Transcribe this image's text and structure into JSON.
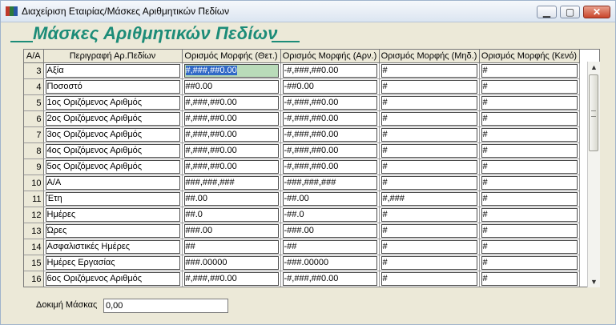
{
  "window": {
    "title": "Διαχείριση Εταιρίας/Μάσκες Αριθμητικών Πεδίων",
    "minimize_glyph": "▁",
    "maximize_glyph": "▢",
    "close_glyph": "✕",
    "icon": "app-logo-icon"
  },
  "header": {
    "title": "Μάσκες Αριθμητικών Πεδίων"
  },
  "grid": {
    "columns": [
      "Α/Α",
      "Περιγραφή Αρ.Πεδίων",
      "Ορισμός Μορφής (Θετ.)",
      "Ορισμός Μορφής (Αρν.)",
      "Ορισμός Μορφής (Μηδ.)",
      "Ορισμός Μορφής (Κενό)"
    ],
    "rows": [
      {
        "num": "3",
        "desc": "Αξία",
        "pos": "#,###,##0.00",
        "neg": "-#,###,##0.00",
        "zero": "#",
        "empty": "#"
      },
      {
        "num": "4",
        "desc": "Ποσοστό",
        "pos": "##0.00",
        "neg": "-##0.00",
        "zero": "#",
        "empty": "#"
      },
      {
        "num": "5",
        "desc": "1ος Οριζόμενος Αριθμός",
        "pos": "#,###,##0.00",
        "neg": "-#,###,##0.00",
        "zero": "#",
        "empty": "#"
      },
      {
        "num": "6",
        "desc": "2ος Οριζόμενος Αριθμός",
        "pos": "#,###,##0.00",
        "neg": "-#,###,##0.00",
        "zero": "#",
        "empty": "#"
      },
      {
        "num": "7",
        "desc": "3ος Οριζόμενος Αριθμός",
        "pos": "#,###,##0.00",
        "neg": "-#,###,##0.00",
        "zero": "#",
        "empty": "#"
      },
      {
        "num": "8",
        "desc": "4ος Οριζόμενος Αριθμός",
        "pos": "#,###,##0.00",
        "neg": "-#,###,##0.00",
        "zero": "#",
        "empty": "#"
      },
      {
        "num": "9",
        "desc": "5ος Οριζόμενος Αριθμός",
        "pos": "#,###,##0.00",
        "neg": "-#,###,##0.00",
        "zero": "#",
        "empty": "#"
      },
      {
        "num": "10",
        "desc": "Α/Α",
        "pos": "###,###,###",
        "neg": "-###,###,###",
        "zero": "#",
        "empty": "#"
      },
      {
        "num": "11",
        "desc": "Έτη",
        "pos": "##.00",
        "neg": "-##.00",
        "zero": "#,###",
        "empty": "#"
      },
      {
        "num": "12",
        "desc": "Ημέρες",
        "pos": "##.0",
        "neg": "-##.0",
        "zero": "#",
        "empty": "#"
      },
      {
        "num": "13",
        "desc": "Ώρες",
        "pos": "###.00",
        "neg": "-###.00",
        "zero": "#",
        "empty": "#"
      },
      {
        "num": "14",
        "desc": "Ασφαλιστικές Ημέρες",
        "pos": "##",
        "neg": "-##",
        "zero": "#",
        "empty": "#"
      },
      {
        "num": "15",
        "desc": "Ημέρες Εργασίας",
        "pos": "###.00000",
        "neg": "-###.00000",
        "zero": "#",
        "empty": "#"
      },
      {
        "num": "16",
        "desc": "6ος Οριζόμενος Αριθμός",
        "pos": "#,###,##0.00",
        "neg": "-#,###,##0.00",
        "zero": "#",
        "empty": "#"
      }
    ],
    "selected_row_index": 0,
    "selected_column": "pos"
  },
  "scrollbar": {
    "up_glyph": "▲",
    "down_glyph": "▼"
  },
  "test_mask": {
    "label": "Δοκιμή Μάσκας",
    "value": "0,00"
  },
  "colors": {
    "accent": "#1c8c78",
    "selection": "#3169c6",
    "selected_cell_bg": "#b9dbb9"
  }
}
